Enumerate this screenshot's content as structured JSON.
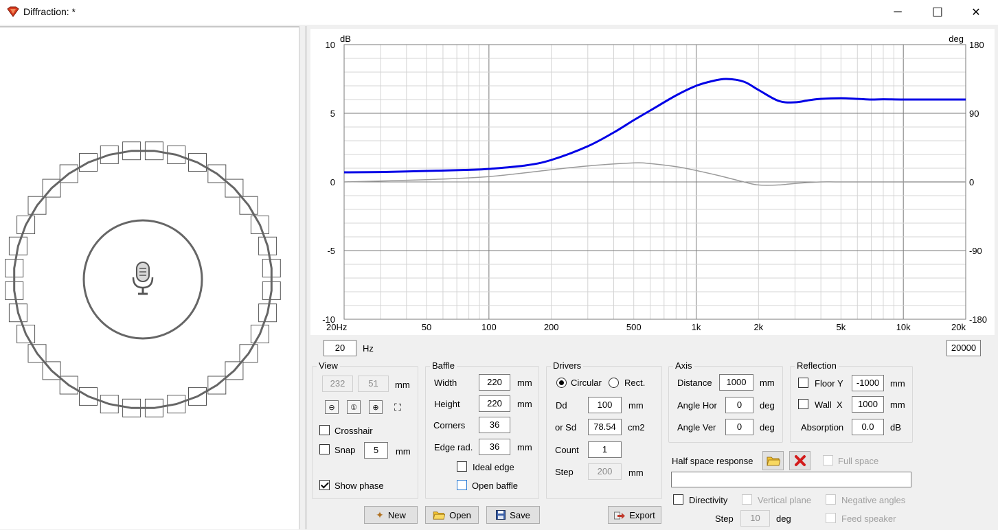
{
  "window": {
    "title": "Diffraction: *",
    "minimize": "─",
    "maximize": "☐",
    "close": "✕"
  },
  "chart_data": {
    "type": "line",
    "title": "",
    "xlabel": "",
    "ylabel": "dB",
    "y2label": "deg",
    "x_scale": "log",
    "xlim": [
      20,
      20000
    ],
    "ylim": [
      -10,
      10
    ],
    "y2lim": [
      -180,
      180
    ],
    "x_ticks": [
      20,
      50,
      100,
      200,
      500,
      1000,
      2000,
      5000,
      10000,
      20000
    ],
    "x_tick_labels": [
      "20Hz",
      "50",
      "100",
      "200",
      "500",
      "1k",
      "2k",
      "5k",
      "10k",
      "20k"
    ],
    "y_ticks": [
      10,
      5,
      0,
      -5,
      -10
    ],
    "y_tick_labels": [
      "10",
      "5",
      "0",
      "-5",
      "-10"
    ],
    "y2_ticks": [
      180,
      90,
      0,
      -90,
      -180
    ],
    "y2_tick_labels": [
      "180",
      "90",
      "0",
      "-90",
      "-180"
    ],
    "grid": true,
    "series": [
      {
        "color": "#0000e6",
        "axis": "left",
        "x": [
          20,
          30,
          50,
          80,
          100,
          150,
          200,
          300,
          400,
          500,
          600,
          800,
          1000,
          1200,
          1400,
          1700,
          2000,
          2500,
          3000,
          3500,
          4000,
          5000,
          6000,
          7000,
          8000,
          10000,
          15000,
          20000
        ],
        "y": [
          0.7,
          0.72,
          0.8,
          0.88,
          0.95,
          1.2,
          1.6,
          2.6,
          3.6,
          4.5,
          5.2,
          6.3,
          7.0,
          7.35,
          7.5,
          7.3,
          6.7,
          5.9,
          5.8,
          5.95,
          6.05,
          6.1,
          6.05,
          6.0,
          6.02,
          6.0,
          6.0,
          6.0
        ]
      },
      {
        "color": "#9a9a9a",
        "axis": "right",
        "x": [
          20,
          50,
          100,
          200,
          300,
          500,
          600,
          800,
          1000,
          1300,
          1700,
          2000,
          2500,
          3000,
          4000,
          5000,
          10000,
          20000
        ],
        "y": [
          0,
          3,
          7,
          16,
          21,
          25,
          24,
          20,
          15,
          8,
          0,
          -4,
          -4,
          -2,
          0,
          0,
          0,
          0
        ]
      }
    ]
  },
  "freq": {
    "min": "20",
    "max": "20000",
    "unit": "Hz"
  },
  "view": {
    "title": "View",
    "x": "232",
    "y": "51",
    "unit": "mm",
    "crosshair": "Crosshair",
    "snap": "Snap",
    "snap_value": "5",
    "snap_unit": "mm",
    "show_phase": "Show phase"
  },
  "baffle": {
    "title": "Baffle",
    "width_label": "Width",
    "width": "220",
    "width_unit": "mm",
    "height_label": "Height",
    "height": "220",
    "height_unit": "mm",
    "corners_label": "Corners",
    "corners": "36",
    "edge_label": "Edge rad.",
    "edge": "36",
    "edge_unit": "mm",
    "ideal_edge": "Ideal edge",
    "open_baffle": "Open baffle"
  },
  "drivers": {
    "title": "Drivers",
    "circular": "Circular",
    "rect": "Rect.",
    "dd_label": "Dd",
    "dd": "100",
    "dd_unit": "mm",
    "sd_label": "or Sd",
    "sd": "78.54",
    "sd_unit": "cm2",
    "count_label": "Count",
    "count": "1",
    "step_label": "Step",
    "step": "200",
    "step_unit": "mm"
  },
  "axis": {
    "title": "Axis",
    "distance_label": "Distance",
    "distance": "1000",
    "distance_unit": "mm",
    "hor_label": "Angle Hor",
    "hor": "0",
    "hor_unit": "deg",
    "ver_label": "Angle Ver",
    "ver": "0",
    "ver_unit": "deg"
  },
  "reflection": {
    "title": "Reflection",
    "floor_label": "Floor Y",
    "floor": "-1000",
    "floor_unit": "mm",
    "wall_label": "Wall",
    "wall_axis": "X",
    "wall": "1000",
    "wall_unit": "mm",
    "absorption_label": "Absorption",
    "absorption": "0.0",
    "absorption_unit": "dB"
  },
  "half_space": {
    "label": "Half space response",
    "full_space": "Full space",
    "path": ""
  },
  "directivity": {
    "label": "Directivity",
    "vertical_plane": "Vertical plane",
    "negative_angles": "Negative angles",
    "step_label": "Step",
    "step": "10",
    "step_unit": "deg",
    "feed_speaker": "Feed speaker"
  },
  "buttons": {
    "new": "New",
    "open": "Open",
    "save": "Save",
    "export": "Export"
  }
}
